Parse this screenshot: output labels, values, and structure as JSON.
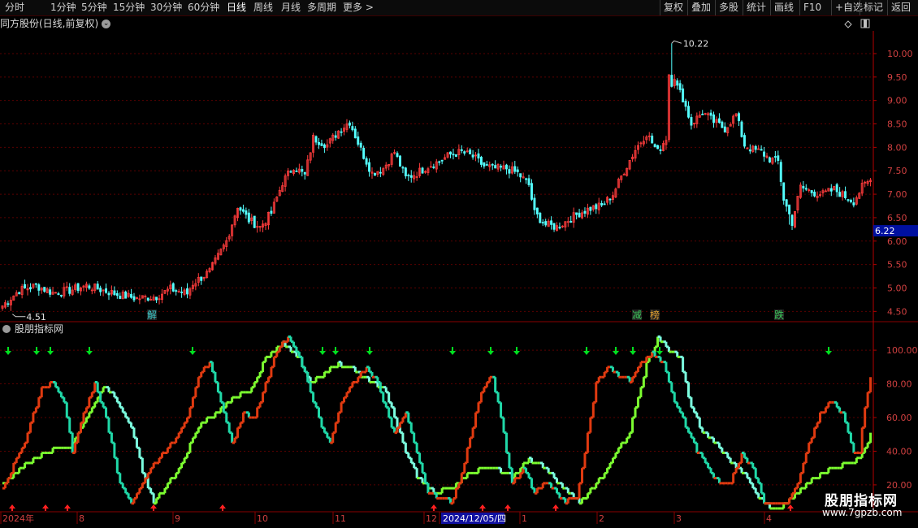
{
  "toolbar": {
    "periods": [
      "分时",
      "1分钟",
      "5分钟",
      "15分钟",
      "30分钟",
      "60分钟",
      "日线",
      "周线",
      "月线",
      "多周期",
      "更多"
    ],
    "active_period": "日线",
    "more_arrow": ">",
    "right_buttons": [
      "复权",
      "叠加",
      "多股",
      "统计",
      "画线",
      "F10",
      "+自选",
      "标记",
      "返回"
    ]
  },
  "main_chart": {
    "title": "同方股份(日线,前复权)",
    "y_ticks": [
      "10.00",
      "9.50",
      "9.00",
      "8.50",
      "8.00",
      "7.50",
      "7.00",
      "6.50",
      "6.00",
      "5.50",
      "5.00",
      "4.50"
    ],
    "y_values": [
      10.0,
      9.5,
      9.0,
      8.5,
      8.0,
      7.5,
      7.0,
      6.5,
      6.0,
      5.5,
      5.0,
      4.5
    ],
    "ylim": [
      4.35,
      10.45
    ],
    "current_price": "6.22",
    "high_label": "10.22",
    "low_label": "4.51",
    "markers": [
      {
        "text": "解",
        "color": "#3cc8c8"
      },
      {
        "text": "减",
        "color": "#3cc85a"
      },
      {
        "text": "榜",
        "color": "#e0a030"
      },
      {
        "text": "跌",
        "color": "#3cc85a"
      }
    ],
    "colors": {
      "up": "#ff3c3c",
      "down": "#54ffff",
      "grid": "#5a0000",
      "axis": "#b40000",
      "price_tag_bg": "#0010a0"
    }
  },
  "indicator": {
    "title": "股朋指标网",
    "y_ticks": [
      "100.00",
      "80.00",
      "60.00",
      "40.00",
      "20.00"
    ],
    "y_values": [
      100,
      80,
      60,
      40,
      20
    ],
    "ylim": [
      5,
      115
    ],
    "colors": {
      "fast_up": "#e03a10",
      "fast_down": "#20d8a8",
      "slow_up": "#7cff30",
      "slow_down": "#7cffe0",
      "down_arrow": "#00e020",
      "up_arrow": "#ff2020"
    }
  },
  "time_axis": {
    "labels": [
      "2024年",
      "8",
      "9",
      "10",
      "11",
      "12",
      "2024/12/05/四",
      "1",
      "2",
      "3",
      "4"
    ]
  },
  "watermark": {
    "main": "股朋指标网",
    "url": "www.7gpzb.com"
  },
  "chart_data": {
    "type": "candlestick",
    "title": "同方股份(日线,前复权)",
    "price_anchors": [
      [
        0,
        4.62
      ],
      [
        6,
        4.95
      ],
      [
        12,
        5.05
      ],
      [
        18,
        4.9
      ],
      [
        24,
        4.95
      ],
      [
        30,
        5.05
      ],
      [
        36,
        4.95
      ],
      [
        42,
        4.85
      ],
      [
        48,
        4.78
      ],
      [
        55,
        4.82
      ],
      [
        60,
        4.98
      ],
      [
        66,
        4.88
      ],
      [
        68,
        5.1
      ],
      [
        74,
        5.35
      ],
      [
        80,
        6.0
      ],
      [
        84,
        6.75
      ],
      [
        88,
        6.45
      ],
      [
        92,
        6.3
      ],
      [
        96,
        6.6
      ],
      [
        100,
        7.25
      ],
      [
        104,
        7.6
      ],
      [
        108,
        7.4
      ],
      [
        111,
        8.2
      ],
      [
        116,
        8.05
      ],
      [
        120,
        8.35
      ],
      [
        124,
        8.55
      ],
      [
        128,
        7.95
      ],
      [
        132,
        7.45
      ],
      [
        136,
        7.55
      ],
      [
        140,
        7.9
      ],
      [
        144,
        7.35
      ],
      [
        148,
        7.45
      ],
      [
        152,
        7.6
      ],
      [
        156,
        7.7
      ],
      [
        160,
        7.85
      ],
      [
        164,
        7.9
      ],
      [
        168,
        7.8
      ],
      [
        172,
        7.6
      ],
      [
        176,
        7.55
      ],
      [
        180,
        7.55
      ],
      [
        184,
        7.45
      ],
      [
        188,
        7.2
      ],
      [
        190,
        6.6
      ],
      [
        194,
        6.35
      ],
      [
        198,
        6.3
      ],
      [
        202,
        6.45
      ],
      [
        206,
        6.6
      ],
      [
        210,
        6.7
      ],
      [
        214,
        6.75
      ],
      [
        218,
        7.0
      ],
      [
        222,
        7.5
      ],
      [
        226,
        7.95
      ],
      [
        230,
        8.3
      ],
      [
        234,
        7.9
      ],
      [
        237,
        8.2
      ],
      [
        240,
        9.4
      ],
      [
        243,
        9.05
      ],
      [
        246,
        8.5
      ],
      [
        250,
        8.75
      ],
      [
        254,
        8.55
      ],
      [
        258,
        8.4
      ],
      [
        262,
        8.7
      ],
      [
        265,
        8.05
      ],
      [
        268,
        7.95
      ],
      [
        271,
        7.9
      ],
      [
        274,
        7.75
      ],
      [
        277,
        7.7
      ],
      [
        279,
        6.9
      ],
      [
        282,
        6.4
      ],
      [
        285,
        7.15
      ],
      [
        289,
        7.05
      ],
      [
        293,
        7.0
      ],
      [
        297,
        7.1
      ],
      [
        301,
        6.95
      ],
      [
        304,
        6.85
      ],
      [
        307,
        7.15
      ],
      [
        310,
        7.3
      ]
    ],
    "bars_count": 311,
    "ylim": [
      4.35,
      10.45
    ],
    "high": 10.22,
    "low": 4.51,
    "last": 6.22
  }
}
